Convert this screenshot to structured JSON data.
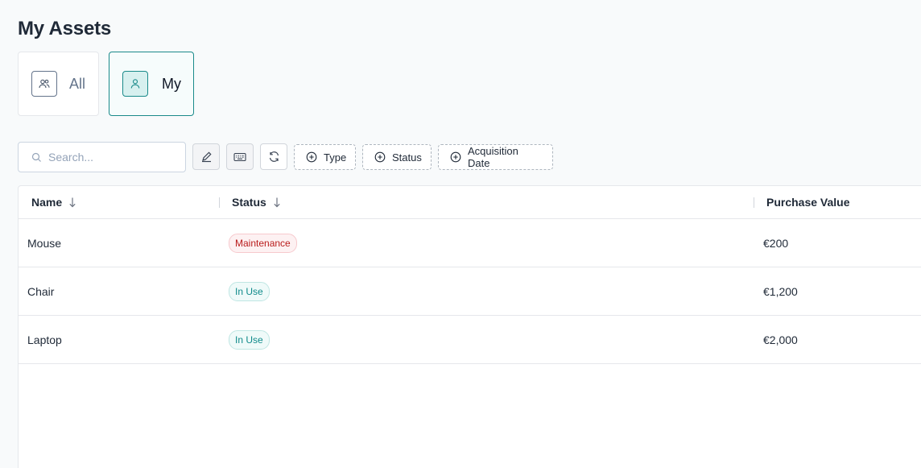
{
  "page": {
    "title": "My Assets"
  },
  "scope": {
    "all_label": "All",
    "my_label": "My",
    "selected": "My"
  },
  "toolbar": {
    "search_placeholder": "Search...",
    "search_value": "",
    "filters": {
      "type": "Type",
      "status": "Status",
      "acquisition_date": "Acquisition Date"
    }
  },
  "table": {
    "columns": {
      "name": "Name",
      "status": "Status",
      "purchase_value": "Purchase Value"
    },
    "rows": [
      {
        "name": "Mouse",
        "status": "Maintenance",
        "purchase_value": "€200"
      },
      {
        "name": "Chair",
        "status": "In Use",
        "purchase_value": "€1,200"
      },
      {
        "name": "Laptop",
        "status": "In Use",
        "purchase_value": "€2,000"
      }
    ]
  },
  "colors": {
    "accent": "#1a8a8a",
    "maintenance": "#b91c1c",
    "in_use": "#0f8a8a"
  },
  "icons": [
    "users-icon",
    "user-icon",
    "search-icon",
    "pen-icon",
    "keyboard-icon",
    "refresh-icon",
    "plus-circle-icon",
    "arrow-down-icon"
  ]
}
